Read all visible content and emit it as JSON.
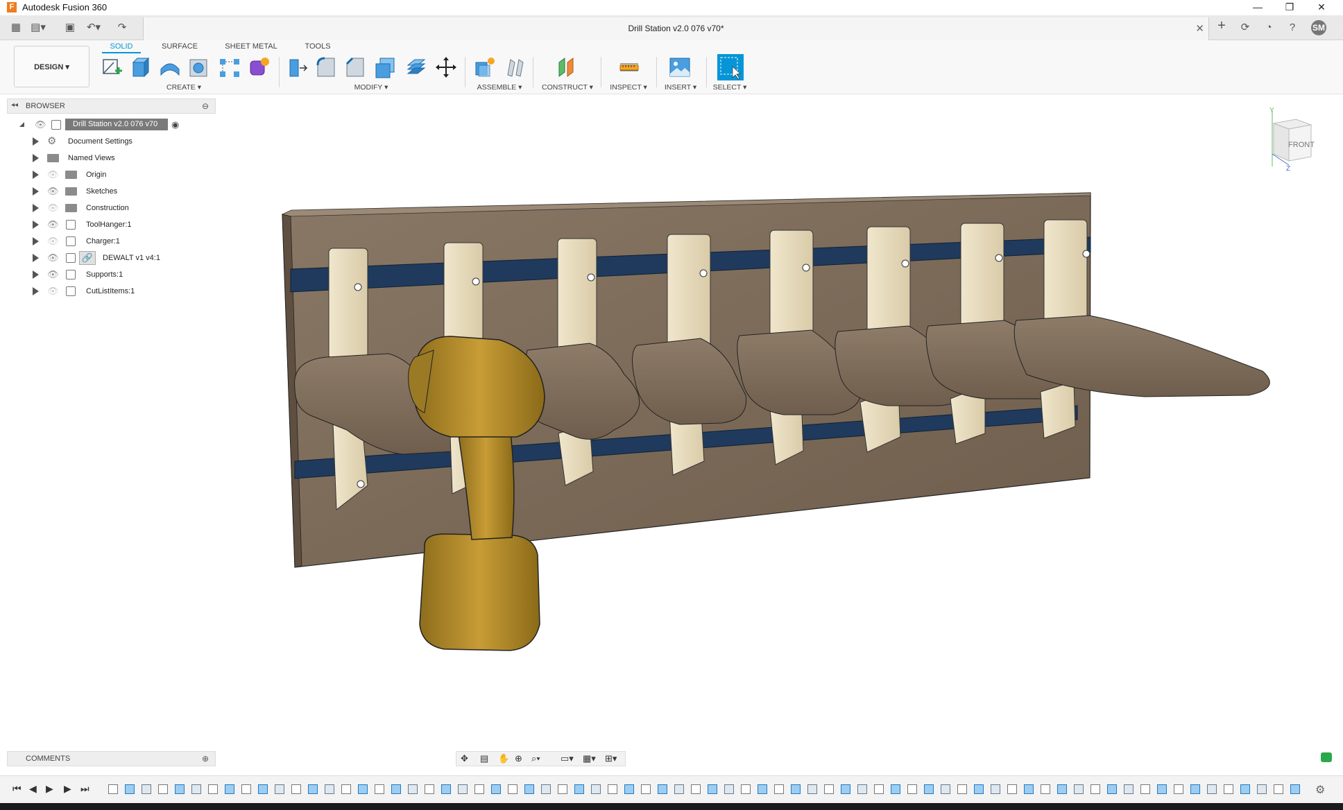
{
  "titlebar": {
    "app_title": "Autodesk Fusion 360",
    "minimize": "—",
    "restore": "❐",
    "close": "✕"
  },
  "document": {
    "title": "Drill Station v2.0 076 v70*",
    "close": "✕"
  },
  "user": {
    "initials": "SM"
  },
  "workspace": {
    "label": "DESIGN ▾"
  },
  "tabs": [
    {
      "label": "SOLID",
      "active": true
    },
    {
      "label": "SURFACE",
      "active": false
    },
    {
      "label": "SHEET METAL",
      "active": false
    },
    {
      "label": "TOOLS",
      "active": false
    }
  ],
  "groups": {
    "create": "CREATE ▾",
    "modify": "MODIFY ▾",
    "assemble": "ASSEMBLE ▾",
    "construct": "CONSTRUCT ▾",
    "inspect": "INSPECT ▾",
    "insert": "INSERT ▾",
    "select": "SELECT ▾"
  },
  "browser": {
    "title": "BROWSER",
    "root": "Drill Station v2.0 076 v70",
    "items": [
      {
        "label": "Document Settings",
        "icon": "gear-icon"
      },
      {
        "label": "Named Views",
        "icon": "folder-icon"
      },
      {
        "label": "Origin",
        "icon": "folder-icon"
      },
      {
        "label": "Sketches",
        "icon": "folder-icon"
      },
      {
        "label": "Construction",
        "icon": "folder-icon"
      },
      {
        "label": "ToolHanger:1",
        "icon": "component-icon"
      },
      {
        "label": "Charger:1",
        "icon": "component-icon"
      },
      {
        "label": "DEWALT v1 v4:1",
        "icon": "link-icon"
      },
      {
        "label": "Supports:1",
        "icon": "component-icon"
      },
      {
        "label": "CutListItems:1",
        "icon": "component-icon"
      }
    ]
  },
  "comments": {
    "title": "COMMENTS"
  },
  "viewcube": {
    "face": "FRONT",
    "axis_y": "Y",
    "axis_z": "Z"
  },
  "colors": {
    "accent": "#0696d7",
    "wood": "#7a6a58",
    "rail": "#1f3a5c",
    "drill": "#b8912e"
  }
}
